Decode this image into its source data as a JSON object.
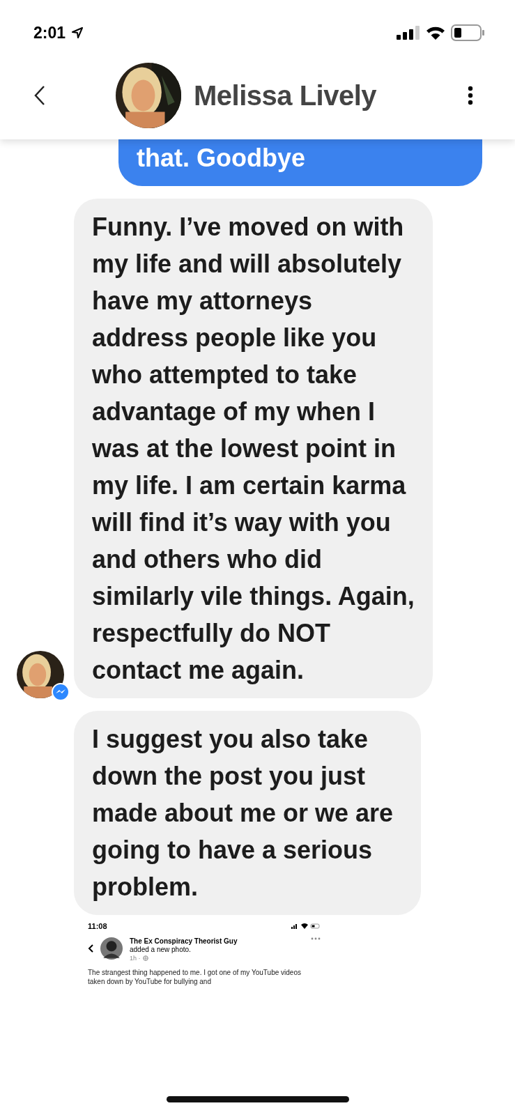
{
  "status_bar": {
    "time": "2:01"
  },
  "header": {
    "name": "Melissa Lively"
  },
  "messages": [
    {
      "kind": "sent",
      "avatar": false,
      "text": "that. Goodbye"
    },
    {
      "kind": "received",
      "avatar": true,
      "text": "Funny. I’ve moved on with my life and will absolutely have my attorneys address people like you who attempted to take advantage of my when I was at the lowest point in my life. I am certain karma will find it’s way with you and others who did similarly vile things. Again, respectfully do NOT contact me again."
    },
    {
      "kind": "received",
      "avatar": false,
      "text": "I suggest you also take down the post you just made about me or we are going to have a serious problem."
    }
  ],
  "attachment": {
    "time": "11:08",
    "author": "The Ex Conspiracy Theorist Guy",
    "action": "added a new photo.",
    "meta": "1h ·",
    "text": "The strangest thing happened to me. I got one of my YouTube videos taken down by YouTube for bullying and"
  }
}
